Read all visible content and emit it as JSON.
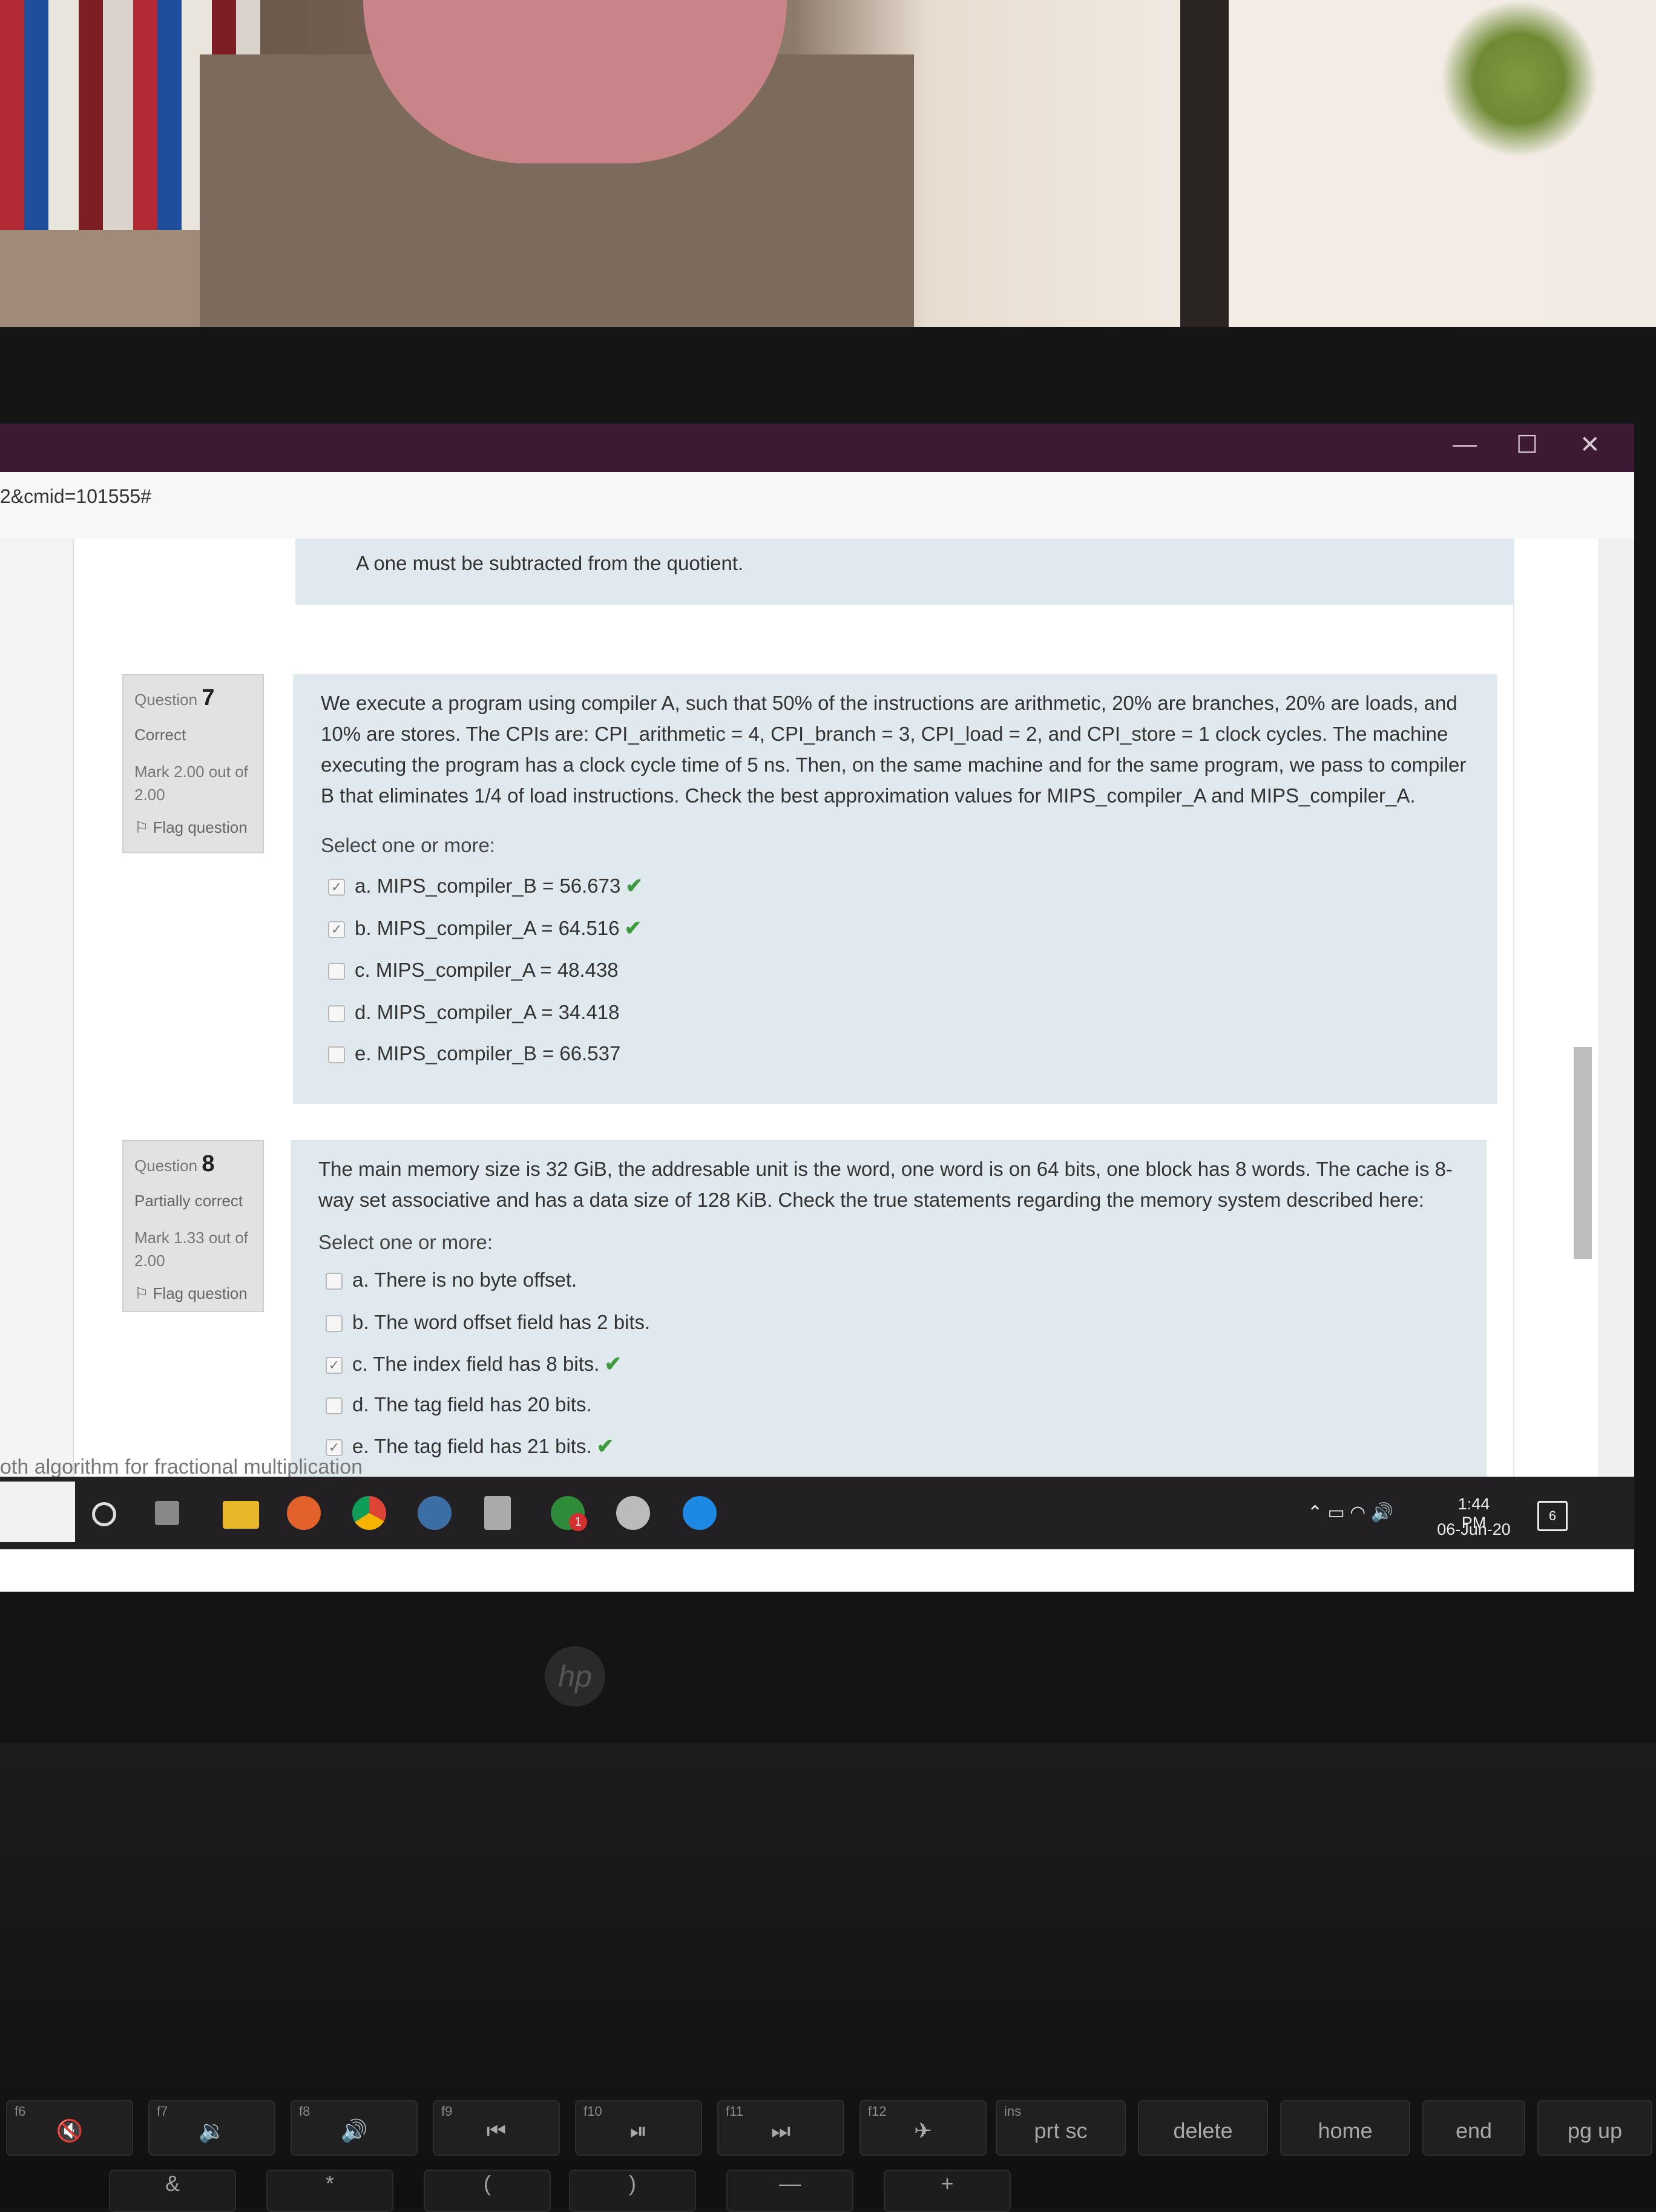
{
  "browser": {
    "url_fragment": "2&cmid=101555#",
    "controls": {
      "minimize": "—",
      "maximize": "☐",
      "close": "✕"
    }
  },
  "previous_answer": "A one must be subtracted from the quotient.",
  "questions": [
    {
      "label": "Question",
      "number": "7",
      "state": "Correct",
      "mark": "Mark 2.00 out of 2.00",
      "flag": "Flag question",
      "text_lines": [
        "We execute a program using compiler A, such that 50% of the instructions are arithmetic, 20% are branches, 20% are loads, and",
        "10% are stores. The CPIs are: CPI_arithmetic = 4, CPI_branch = 3, CPI_load = 2, and CPI_store = 1 clock cycles. The machine",
        "executing the program has a clock cycle time of 5 ns. Then, on the same machine and for the same program, we pass to compiler",
        "B that eliminates 1/4 of load instructions. Check the best approximation values for MIPS_compiler_A and MIPS_compiler_A."
      ],
      "select_label": "Select one or more:",
      "options": [
        {
          "text": "a. MIPS_compiler_B = 56.673",
          "checked": true,
          "correct": true
        },
        {
          "text": "b. MIPS_compiler_A = 64.516",
          "checked": true,
          "correct": true
        },
        {
          "text": "c. MIPS_compiler_A = 48.438",
          "checked": false,
          "correct": false
        },
        {
          "text": "d. MIPS_compiler_A = 34.418",
          "checked": false,
          "correct": false
        },
        {
          "text": "e. MIPS_compiler_B = 66.537",
          "checked": false,
          "correct": false
        }
      ]
    },
    {
      "label": "Question",
      "number": "8",
      "state": "Partially correct",
      "mark": "Mark 1.33 out of 2.00",
      "flag": "Flag question",
      "text_lines": [
        "The main memory size is 32 GiB, the addresable unit is the word, one word is on 64 bits, one block has 8 words. The cache is 8-",
        "way set associative and has a data size of 128 KiB. Check the true statements regarding the memory system described here:"
      ],
      "select_label": "Select one or more:",
      "options": [
        {
          "text": "a. There is no byte offset.",
          "checked": false,
          "correct": false
        },
        {
          "text": "b. The word offset field has 2 bits.",
          "checked": false,
          "correct": false
        },
        {
          "text": "c. The index field has 8 bits.",
          "checked": true,
          "correct": true
        },
        {
          "text": "d. The tag field has 20 bits.",
          "checked": false,
          "correct": false
        },
        {
          "text": "e. The tag field has 21 bits.",
          "checked": true,
          "correct": true
        }
      ]
    }
  ],
  "cutoff_text": "oth algorithm for fractional multiplication",
  "taskbar": {
    "time": "1:44 PM",
    "date": "06-Jun-20",
    "notification_count": "6",
    "badge_count": "1"
  },
  "brand": "hp",
  "keyboard": {
    "function_row": [
      {
        "fn": "f6",
        "label": "🔇"
      },
      {
        "fn": "f7",
        "label": "🔉"
      },
      {
        "fn": "f8",
        "label": "🔊"
      },
      {
        "fn": "f9",
        "label": "⏮"
      },
      {
        "fn": "f10",
        "label": "⏯"
      },
      {
        "fn": "f11",
        "label": "⏭"
      },
      {
        "fn": "f12",
        "label": "✈"
      },
      {
        "fn": "ins",
        "label": "prt sc"
      },
      {
        "fn": "",
        "label": "delete"
      },
      {
        "fn": "",
        "label": "home"
      },
      {
        "fn": "",
        "label": "end"
      },
      {
        "fn": "",
        "label": "pg up"
      }
    ],
    "number_row": [
      "&",
      "*",
      "(",
      ")",
      "—",
      "+"
    ]
  }
}
